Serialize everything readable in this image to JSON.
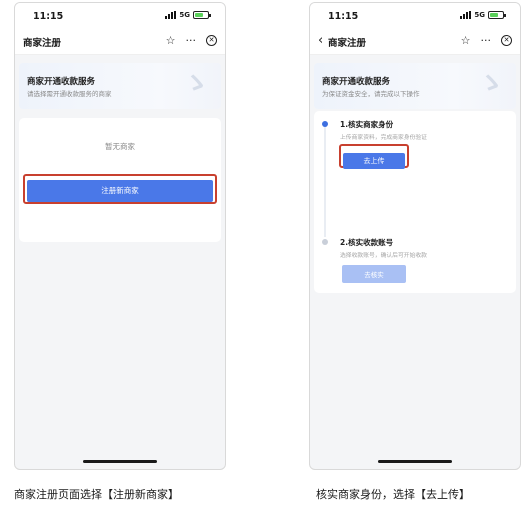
{
  "left_screen": {
    "status": {
      "time": "11:15",
      "network": "5G"
    },
    "nav_title": "商家注册",
    "banner_title": "商家开通收款服务",
    "banner_subtitle": "请选择需开通收款服务的商家",
    "empty_text": "暂无商家",
    "register_button": "注册新商家",
    "caption": "商家注册页面选择【注册新商家】"
  },
  "right_screen": {
    "status": {
      "time": "11:15",
      "network": "5G"
    },
    "back_icon": "chevron-left-icon",
    "nav_title": "商家注册",
    "banner_title": "商家开通收款服务",
    "banner_subtitle": "为保证资金安全，请完成以下操作",
    "steps": [
      {
        "title": "1.核实商家身份",
        "desc": "上传商家资料，完成商家身份验证",
        "button": "去上传",
        "state": "active"
      },
      {
        "title": "2.核实收款账号",
        "desc": "选择收款账号，确认后可开始收款",
        "button": "去核实",
        "state": "disabled"
      }
    ],
    "caption": "核实商家身份，选择【去上传】"
  },
  "icons": {
    "nav": [
      "star-icon",
      "more-icon",
      "close-icon"
    ],
    "status": [
      "signal-icon",
      "battery-icon"
    ]
  },
  "colors": {
    "primary": "#4a78e8",
    "primary_disabled": "#a9c0f4",
    "highlight": "#c8402f",
    "battery": "#5ad05a"
  }
}
